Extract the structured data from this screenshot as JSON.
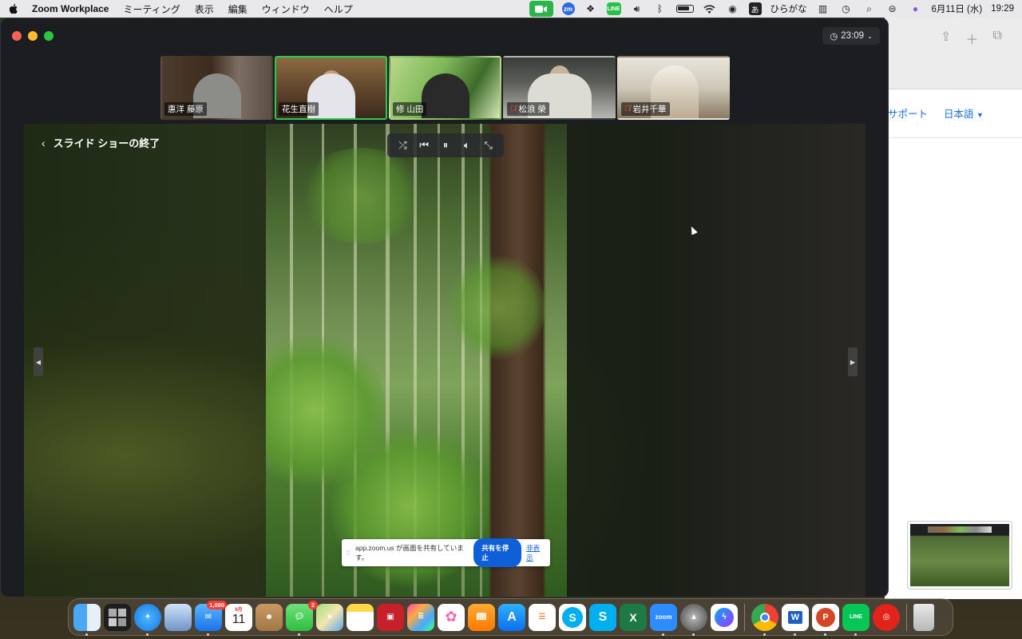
{
  "menubar": {
    "app_name": "Zoom Workplace",
    "menus": [
      "ミーティング",
      "表示",
      "編集",
      "ウィンドウ",
      "ヘルプ"
    ],
    "ime_icon": "あ",
    "ime_label": "ひらがな",
    "date": "6月11日 (水)",
    "time": "19:29"
  },
  "browser_bg": {
    "nav_support": "サポート",
    "nav_language": "日本語"
  },
  "zoom": {
    "timer": "23:09",
    "participants": [
      {
        "name": "惠洋 藤原",
        "muted": false,
        "active": false
      },
      {
        "name": "花生直樹",
        "muted": false,
        "active": true
      },
      {
        "name": "修 山田",
        "muted": false,
        "active": false
      },
      {
        "name": "松浪 榮",
        "muted": true,
        "active": false
      },
      {
        "name": "岩井千華",
        "muted": true,
        "active": false
      }
    ],
    "slideshow": {
      "back_label": "スライド ショーの終了"
    },
    "share_banner": {
      "message": "app.zoom.us が画面を共有しています。",
      "stop_label": "共有を停止",
      "hide_label": "非表示"
    }
  },
  "dock": {
    "mail_badge": "1,080",
    "messages_badge": "2",
    "calendar_month": "6月",
    "calendar_day": "11",
    "zoom_label": "zoom",
    "word_label": "W",
    "line_label": "LINE"
  }
}
